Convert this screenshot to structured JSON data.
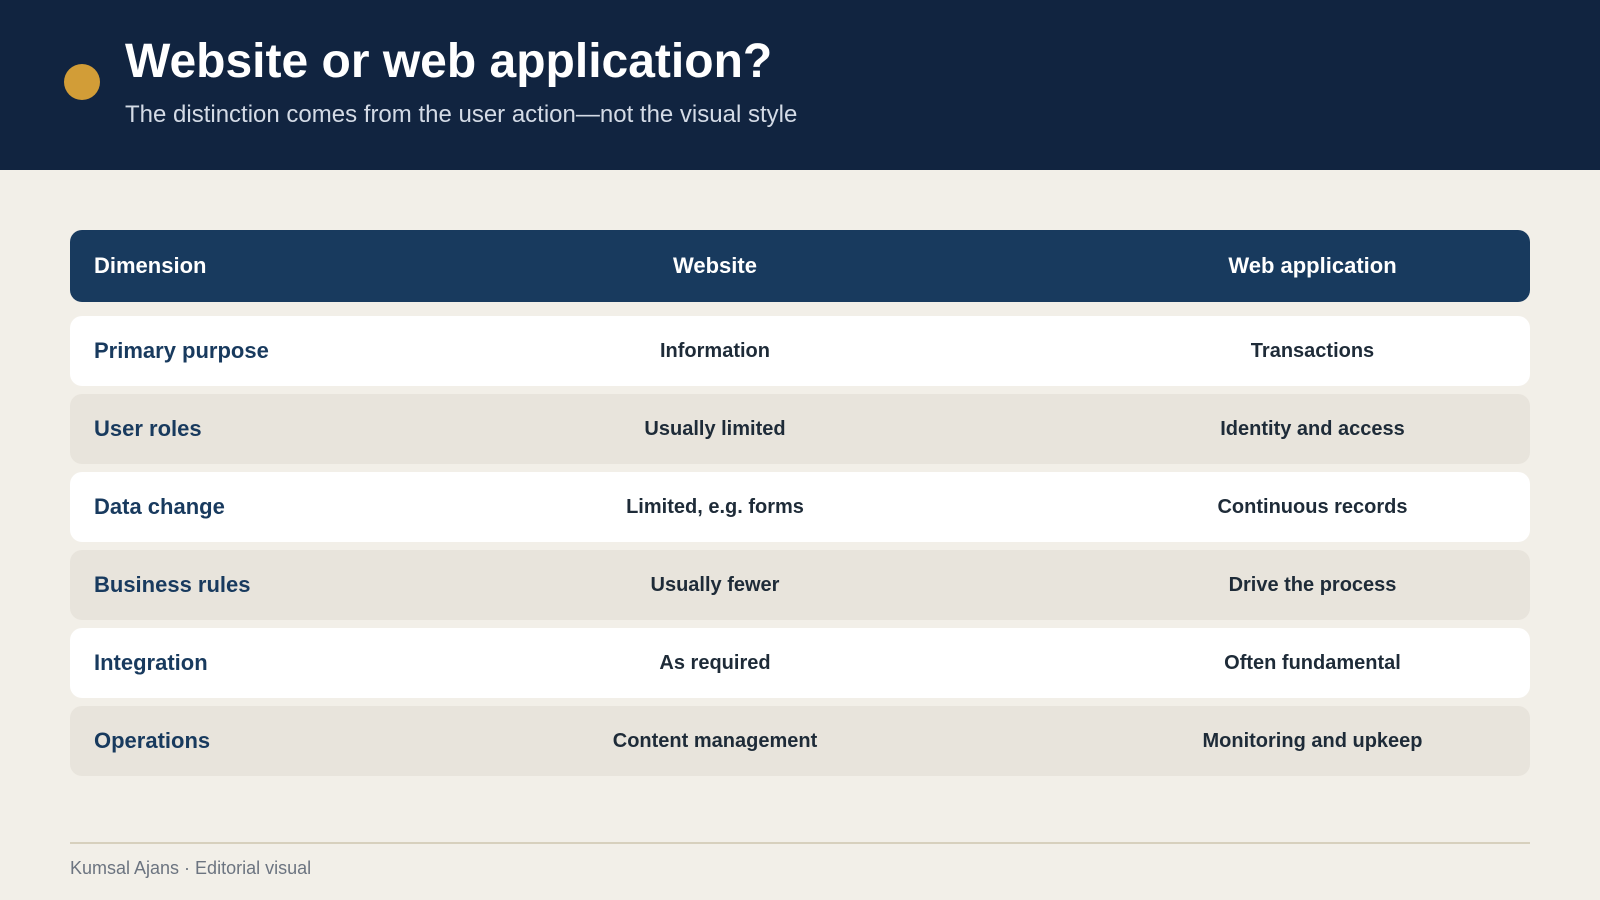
{
  "header": {
    "title": "Website or web application?",
    "subtitle": "The distinction comes from the user action—not the visual style"
  },
  "table": {
    "columns": [
      "Dimension",
      "Website",
      "Web application"
    ],
    "rows": [
      {
        "dimension": "Primary purpose",
        "website": "Information",
        "webapp": "Transactions"
      },
      {
        "dimension": "User roles",
        "website": "Usually limited",
        "webapp": "Identity and access"
      },
      {
        "dimension": "Data change",
        "website": "Limited, e.g. forms",
        "webapp": "Continuous records"
      },
      {
        "dimension": "Business rules",
        "website": "Usually fewer",
        "webapp": "Drive the process"
      },
      {
        "dimension": "Integration",
        "website": "As required",
        "webapp": "Often fundamental"
      },
      {
        "dimension": "Operations",
        "website": "Content management",
        "webapp": "Monitoring and upkeep"
      }
    ]
  },
  "footer": {
    "credit": "Kumsal Ajans · Editorial visual"
  },
  "colors": {
    "header_bg": "#112440",
    "accent": "#d29d37",
    "table_header_bg": "#183a5e",
    "page_bg": "#f2efe8"
  }
}
